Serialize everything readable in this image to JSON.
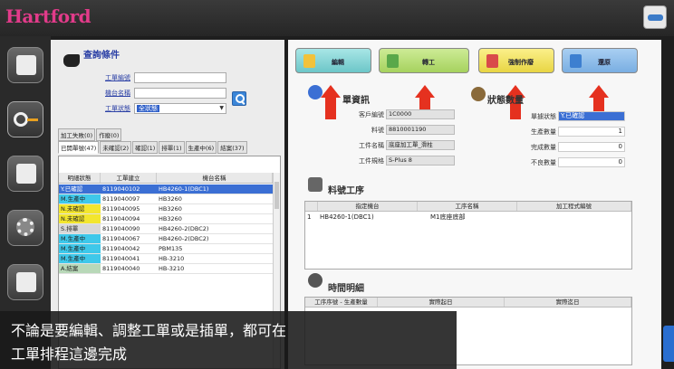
{
  "app": {
    "logo": "Hartford"
  },
  "query": {
    "title": "查詢條件",
    "fields": [
      {
        "label": "工單編號",
        "value": ""
      },
      {
        "label": "機台名稱",
        "value": ""
      },
      {
        "label": "工單狀態",
        "value": "全狀態"
      }
    ]
  },
  "tabs_row1": [
    "加工失敗(0)",
    "作廢(0)"
  ],
  "tabs_row2": [
    "已開單號(47)",
    "未確認(2)",
    "確認(1)",
    "排單(1)",
    "生產中(6)",
    "結案(37)"
  ],
  "grid": {
    "headers": [
      "明細狀態",
      "工單建立",
      "機台名稱"
    ],
    "rows": [
      {
        "status": "Y.已確認",
        "order": "8119040102",
        "machine": "HB4260-1(DBC1)",
        "color": "#3b6fd4"
      },
      {
        "status": "M.生產中",
        "order": "8119040097",
        "machine": "HB3260",
        "color": "#3ec8ea"
      },
      {
        "status": "N.未確認",
        "order": "8119040095",
        "machine": "HB3260",
        "color": "#f3e62e"
      },
      {
        "status": "N.未確認",
        "order": "8119040094",
        "machine": "HB3260",
        "color": "#f3e62e"
      },
      {
        "status": "S.排單",
        "order": "8119040090",
        "machine": "HB4260-2(DBC2)",
        "color": "#d8d8d8"
      },
      {
        "status": "M.生產中",
        "order": "8119040067",
        "machine": "HB4260-2(DBC2)",
        "color": "#3ec8ea"
      },
      {
        "status": "M.生產中",
        "order": "8119040042",
        "machine": "PBM135",
        "color": "#3ec8ea"
      },
      {
        "status": "M.生產中",
        "order": "8119040041",
        "machine": "HB-3210",
        "color": "#3ec8ea"
      },
      {
        "status": "A.結案",
        "order": "8119040040",
        "machine": "HB-3210",
        "color": "#b8d8b8"
      }
    ]
  },
  "actions": {
    "edit": "編輯",
    "adjust": "轉工",
    "force": "強制作廢",
    "restore": "還原"
  },
  "order_info": {
    "title": "單資訊",
    "fields": [
      {
        "label": "客戶編號",
        "value": "1C0000"
      },
      {
        "label": "料號",
        "value": "8810001190"
      },
      {
        "label": "工件名稱",
        "value": "底座加工單_滑柱"
      },
      {
        "label": "工件規格",
        "value": "S-Plus 8"
      }
    ]
  },
  "status_qty": {
    "title": "狀態數量",
    "rows": [
      {
        "label": "單據狀態",
        "value": "Y.已確認"
      },
      {
        "label": "生產數量",
        "value": "1"
      },
      {
        "label": "完成數量",
        "value": "0"
      },
      {
        "label": "不良數量",
        "value": "0"
      }
    ]
  },
  "process": {
    "title": "料號工序",
    "headers": [
      "指定機台",
      "工序名稱",
      "加工程式編號"
    ],
    "rows": [
      {
        "no": "1",
        "machine": "HB4260-1(DBC1)",
        "step": "M1底座底部",
        "program": ""
      }
    ]
  },
  "time": {
    "title": "時間明細",
    "headers": [
      "工序序號 - 生產數量",
      "實際起日",
      "實際迄日"
    ]
  },
  "caption": {
    "line1": "不論是要編輯、調整工單或是插單，都可在",
    "line2": "工單排程這邊完成"
  }
}
